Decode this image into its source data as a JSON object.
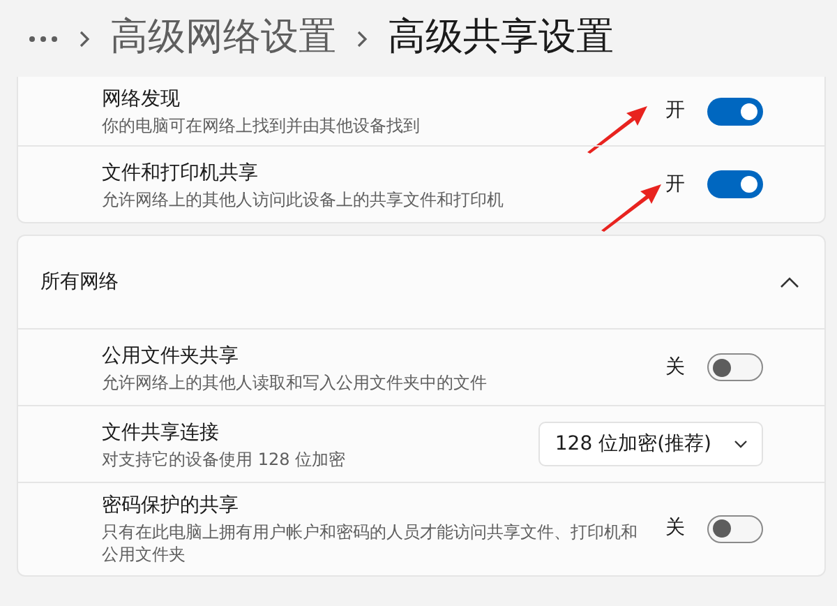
{
  "breadcrumb": [
    {
      "label": "高级网络设置",
      "current": false
    },
    {
      "label": "高级共享设置",
      "current": true
    }
  ],
  "groups": [
    {
      "rows": [
        {
          "kind": "toggle",
          "title": "网络发现",
          "description": "你的电脑可在网络上找到并由其他设备找到",
          "state_label": "开",
          "on": true,
          "annotated": true
        },
        {
          "kind": "toggle",
          "title": "文件和打印机共享",
          "description": "允许网络上的其他人访问此设备上的共享文件和打印机",
          "state_label": "开",
          "on": true,
          "annotated": true
        }
      ]
    },
    {
      "header": {
        "title": "所有网络",
        "expanded": true
      },
      "rows": [
        {
          "kind": "toggle",
          "title": "公用文件夹共享",
          "description": "允许网络上的其他人读取和写入公用文件夹中的文件",
          "state_label": "关",
          "on": false,
          "annotated": false
        },
        {
          "kind": "dropdown",
          "title": "文件共享连接",
          "description": "对支持它的设备使用 128 位加密",
          "value": "128 位加密(推荐)"
        },
        {
          "kind": "toggle",
          "title": "密码保护的共享",
          "description": "只有在此电脑上拥有用户帐户和密码的人员才能访问共享文件、打印机和公用文件夹",
          "state_label": "关",
          "on": false,
          "annotated": false
        }
      ]
    }
  ]
}
